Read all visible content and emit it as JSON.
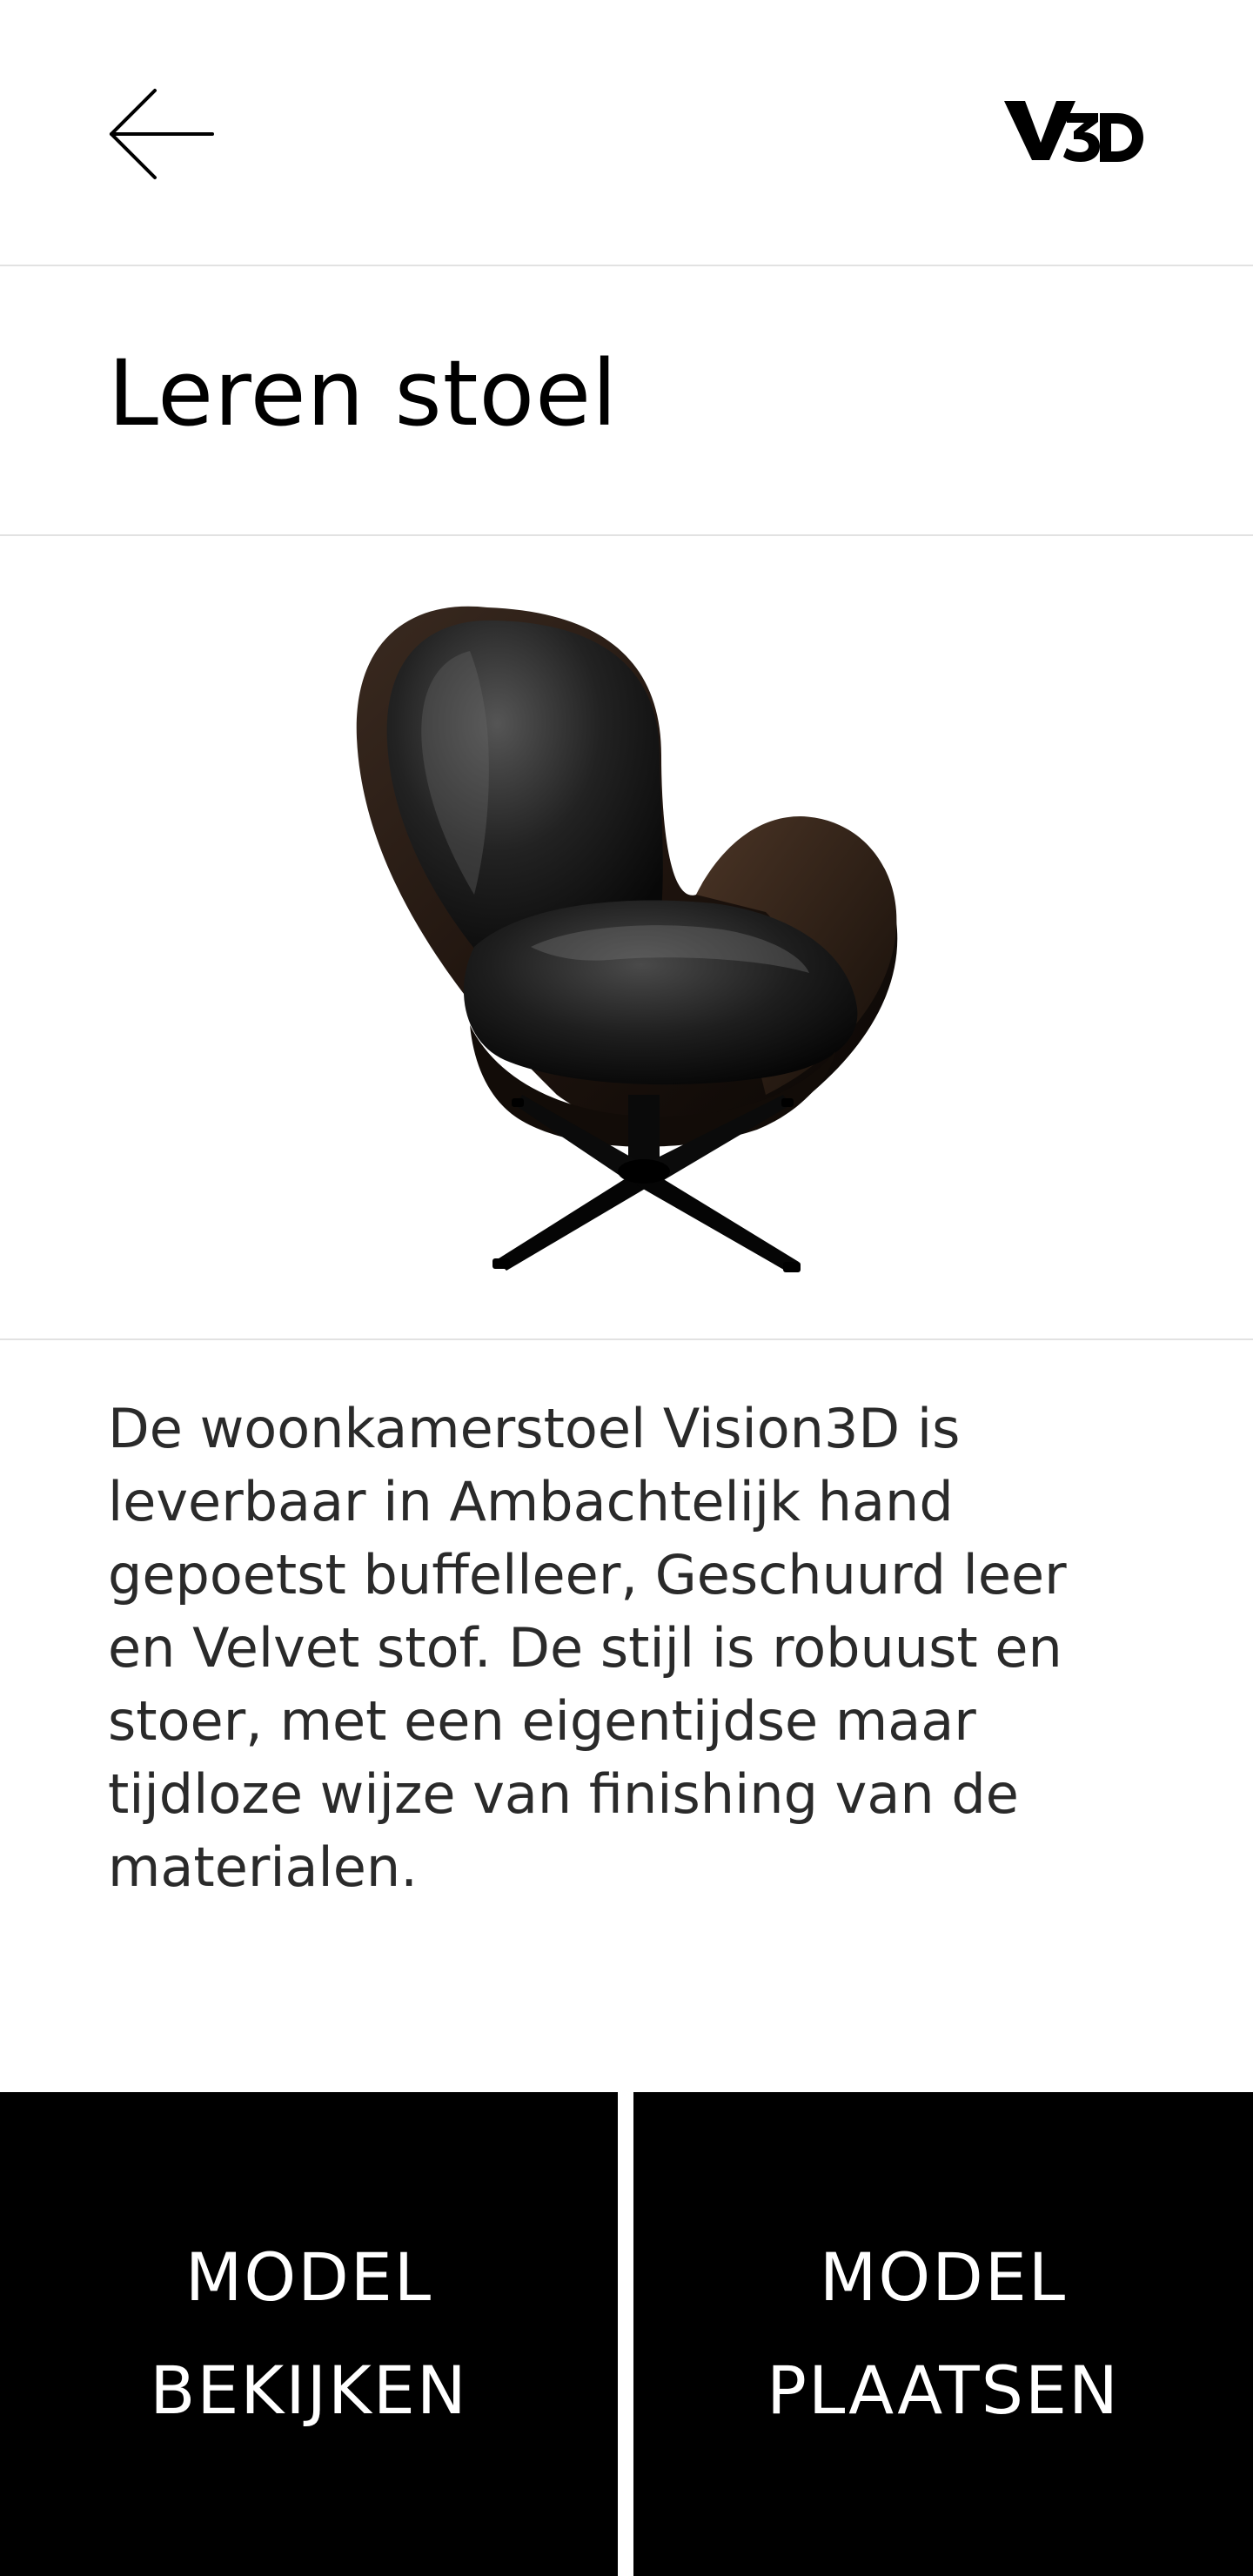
{
  "header": {
    "back_icon": "arrow-left-icon",
    "logo_icon": "v3d-logo"
  },
  "product": {
    "title": "Leren stoel",
    "image": "leather-swivel-chair",
    "description": "De woonkamerstoel Vision3D is leverbaar in Ambachtelijk hand gepoetst buffelleer, Geschuurd leer en Velvet stof. De stijl is robuust en stoer, met een eigentijdse maar tijdloze wijze van finishing van de materialen."
  },
  "actions": {
    "view_line1": "MODEL",
    "view_line2": "BEKIJKEN",
    "place_line1": "MODEL",
    "place_line2": "PLAATSEN"
  },
  "colors": {
    "background": "#ffffff",
    "button": "#000000",
    "button_text": "#ffffff",
    "divider": "#e2e2e2",
    "text": "#2a2a2a"
  }
}
